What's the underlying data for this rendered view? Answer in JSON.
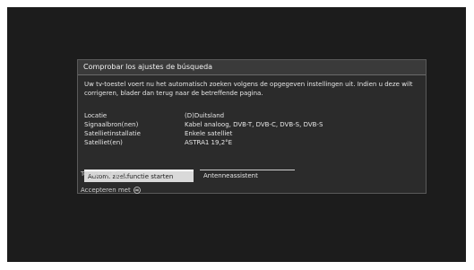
{
  "dialog": {
    "title": "Comprobar los ajustes de búsqueda",
    "intro": "Uw tv-toestel voert nu het automatisch zoeken volgens de opgegeven instellingen uit. Indien u deze wilt corrigeren, blader dan terug naar de betreffende pagina.",
    "settings": [
      {
        "label": "Locatie",
        "value": "(D)Duitsland"
      },
      {
        "label": "Signaalbron(nen)",
        "value": "Kabel analoog, DVB-T, DVB-C, DVB-S, DVB-S"
      },
      {
        "label": "Satellietinstallatie",
        "value": "Enkele satelliet"
      },
      {
        "label": "Satelliet(en)",
        "value": "ASTRA1 19,2°E"
      }
    ],
    "buttons": {
      "start_search": "Autom. zoekfunctie starten",
      "antenna_assistant": "Antenneassistent"
    }
  },
  "hints": {
    "back": "Terug met",
    "back_key_icon": "back-key-icon",
    "accept": "Accepteren met",
    "accept_key_icon": "ok-key-icon"
  }
}
